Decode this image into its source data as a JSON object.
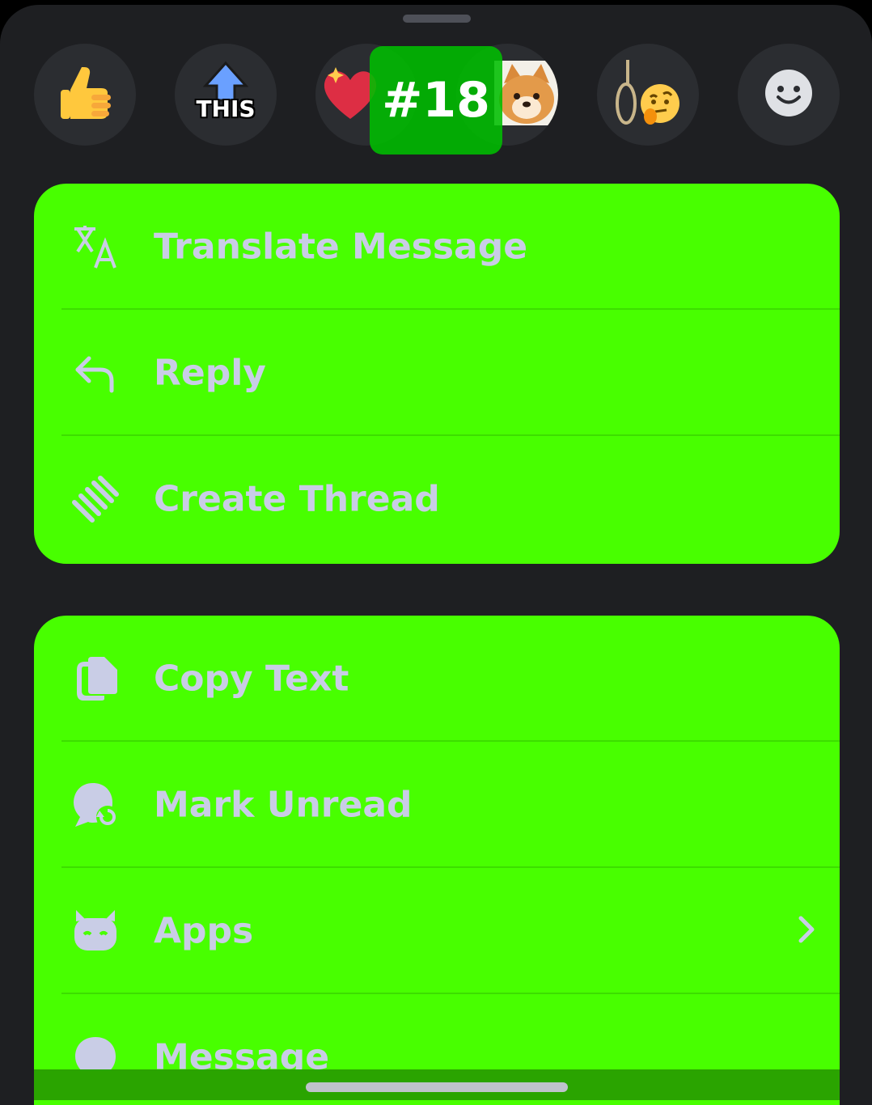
{
  "reactions": [
    {
      "name": "thumbs-up-icon"
    },
    {
      "name": "this-arrow-icon",
      "text": "THIS"
    },
    {
      "name": "sparkling-heart-icon"
    },
    {
      "name": "shiba-dog-icon"
    },
    {
      "name": "noose-thinking-icon"
    },
    {
      "name": "add-reaction-icon"
    }
  ],
  "badge": {
    "text": "#18"
  },
  "group1": [
    {
      "label": "Translate Message",
      "icon": "translate-icon"
    },
    {
      "label": "Reply",
      "icon": "reply-arrow-icon"
    },
    {
      "label": "Create Thread",
      "icon": "thread-icon"
    }
  ],
  "group2": [
    {
      "label": "Copy Text",
      "icon": "copy-icon"
    },
    {
      "label": "Mark Unread",
      "icon": "mark-unread-icon"
    },
    {
      "label": "Apps",
      "icon": "apps-robot-icon"
    },
    {
      "label": "Message",
      "icon": "message-bubble-icon"
    }
  ],
  "colors": {
    "sheet_bg": "#1e1f22",
    "reaction_bg": "#2b2d31",
    "menu_bg": "#48ff00",
    "menu_text": "#c9cde6"
  }
}
